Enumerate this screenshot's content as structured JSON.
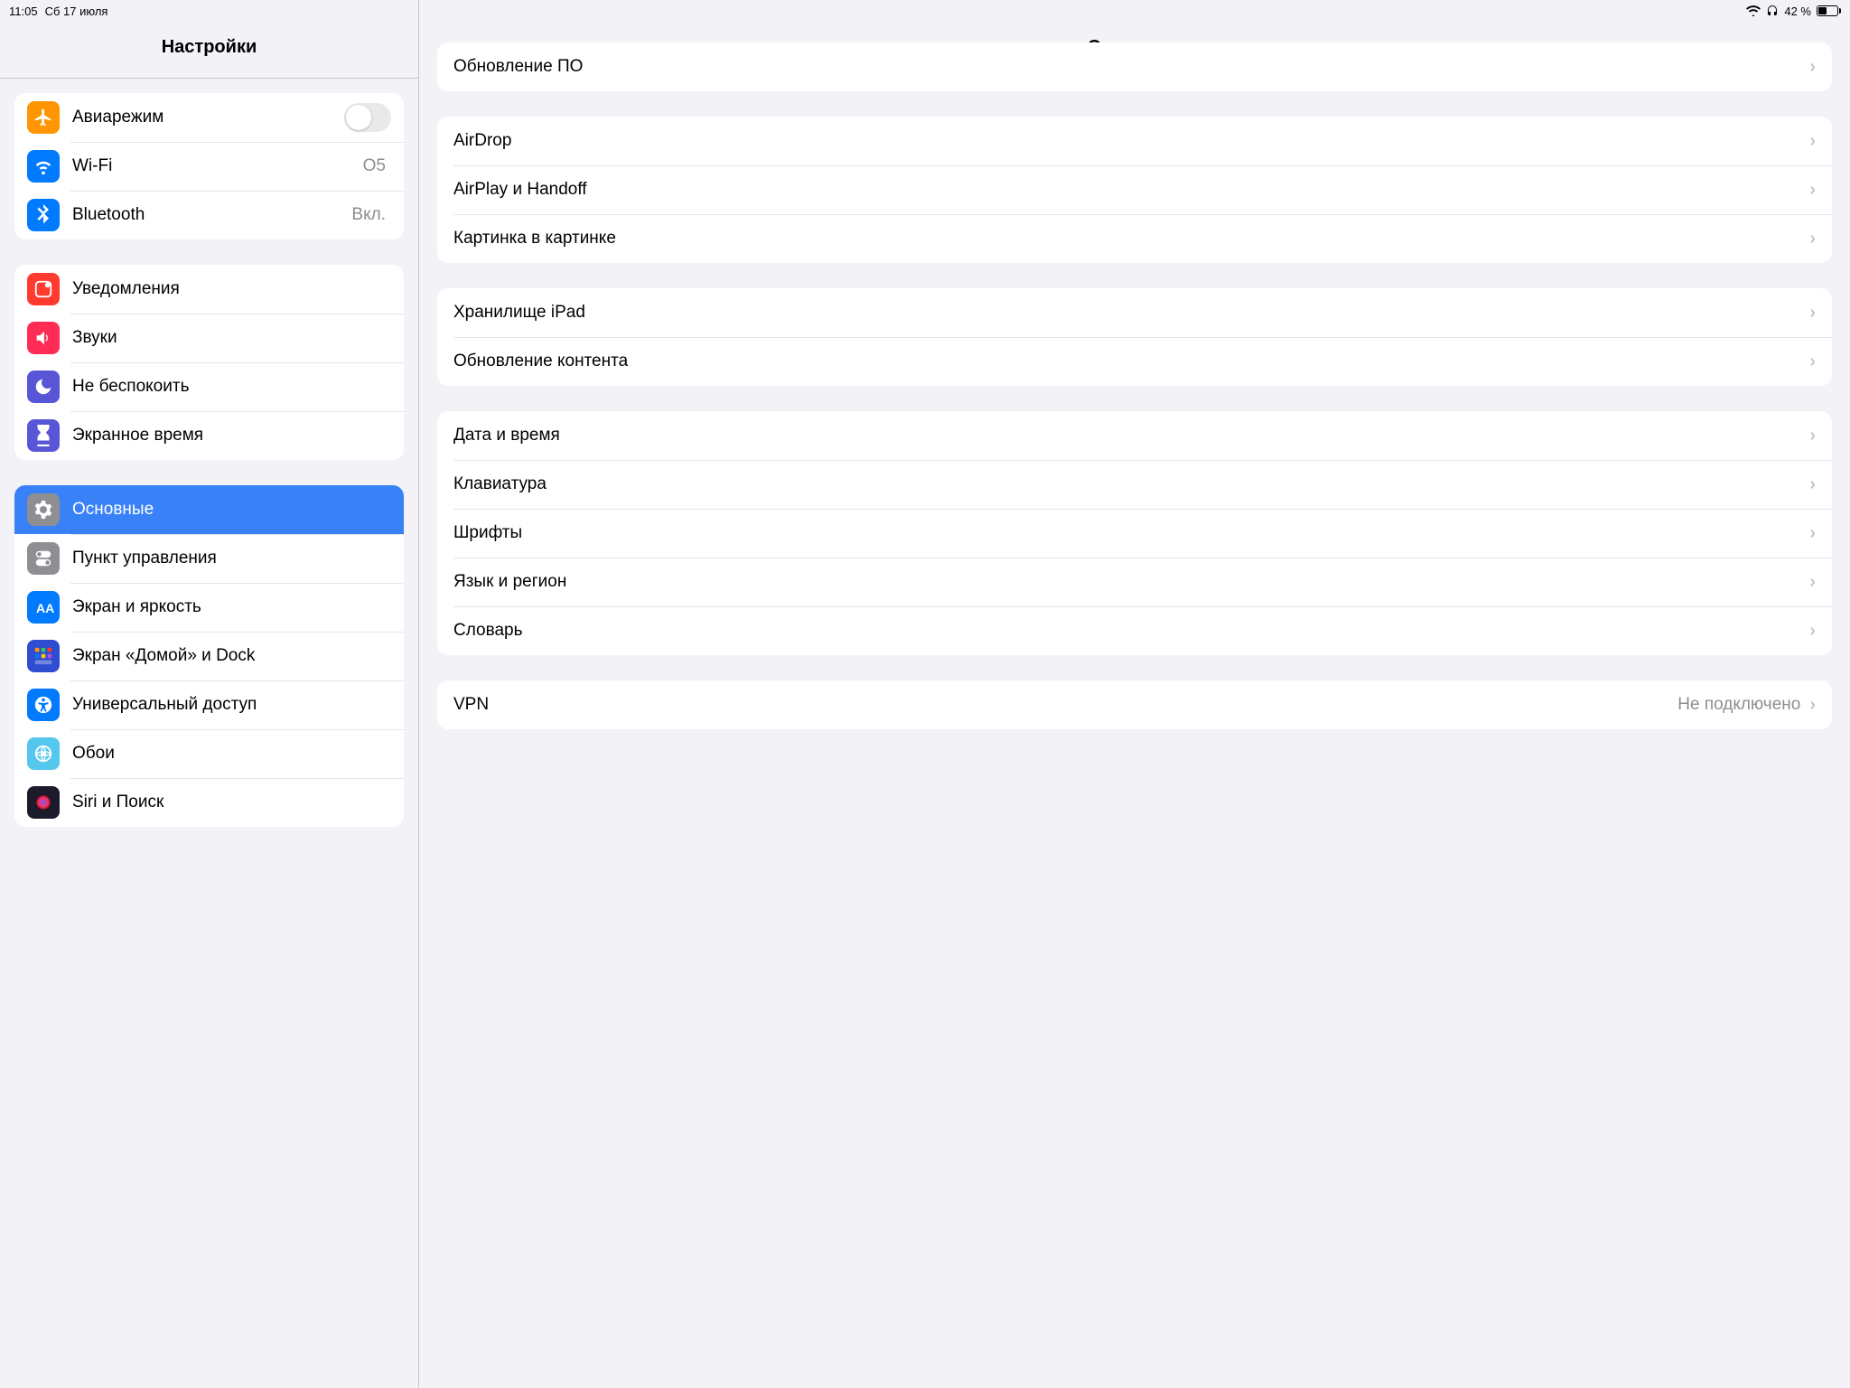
{
  "statusbar": {
    "time": "11:05",
    "date": "Сб 17 июля",
    "battery_text": "42 %"
  },
  "titles": {
    "sidebar": "Настройки",
    "main": "Основные"
  },
  "sidebar": {
    "groups": [
      {
        "rows": [
          {
            "id": "airplane",
            "label": "Авиарежим",
            "iconColor": "#ff9500",
            "toggle": true
          },
          {
            "id": "wifi",
            "label": "Wi-Fi",
            "iconColor": "#007aff",
            "value": "O5"
          },
          {
            "id": "bluetooth",
            "label": "Bluetooth",
            "iconColor": "#007aff",
            "value": "Вкл."
          }
        ]
      },
      {
        "rows": [
          {
            "id": "notifications",
            "label": "Уведомления",
            "iconColor": "#ff3b30"
          },
          {
            "id": "sounds",
            "label": "Звуки",
            "iconColor": "#ff2d55"
          },
          {
            "id": "dnd",
            "label": "Не беспокоить",
            "iconColor": "#5856d6"
          },
          {
            "id": "screentime",
            "label": "Экранное время",
            "iconColor": "#5856d6"
          }
        ]
      },
      {
        "rows": [
          {
            "id": "general",
            "label": "Основные",
            "iconColor": "#8e8e93",
            "selected": true
          },
          {
            "id": "controlcenter",
            "label": "Пункт управления",
            "iconColor": "#8e8e93"
          },
          {
            "id": "display",
            "label": "Экран и яркость",
            "iconColor": "#007aff"
          },
          {
            "id": "home",
            "label": "Экран «Домой» и Dock",
            "iconColor": "#2f4dd1"
          },
          {
            "id": "accessibility",
            "label": "Универсальный доступ",
            "iconColor": "#007aff"
          },
          {
            "id": "wallpaper",
            "label": "Обои",
            "iconColor": "#54c7ec"
          },
          {
            "id": "siri",
            "label": "Siri и Поиск",
            "iconColor": "#1b1b2c"
          }
        ]
      }
    ]
  },
  "main": {
    "groups": [
      {
        "rows": [
          {
            "id": "swupdate",
            "label": "Обновление ПО"
          }
        ]
      },
      {
        "rows": [
          {
            "id": "airdrop",
            "label": "AirDrop"
          },
          {
            "id": "airplay",
            "label": "AirPlay и Handoff"
          },
          {
            "id": "pip",
            "label": "Картинка в картинке"
          }
        ]
      },
      {
        "rows": [
          {
            "id": "storage",
            "label": "Хранилище iPad"
          },
          {
            "id": "bgrefresh",
            "label": "Обновление контента"
          }
        ]
      },
      {
        "rows": [
          {
            "id": "datetime",
            "label": "Дата и время"
          },
          {
            "id": "keyboard",
            "label": "Клавиатура"
          },
          {
            "id": "fonts",
            "label": "Шрифты"
          },
          {
            "id": "language",
            "label": "Язык и регион"
          },
          {
            "id": "dictionary",
            "label": "Словарь"
          }
        ]
      },
      {
        "rows": [
          {
            "id": "vpn",
            "label": "VPN",
            "value": "Не подключено"
          }
        ]
      }
    ]
  }
}
